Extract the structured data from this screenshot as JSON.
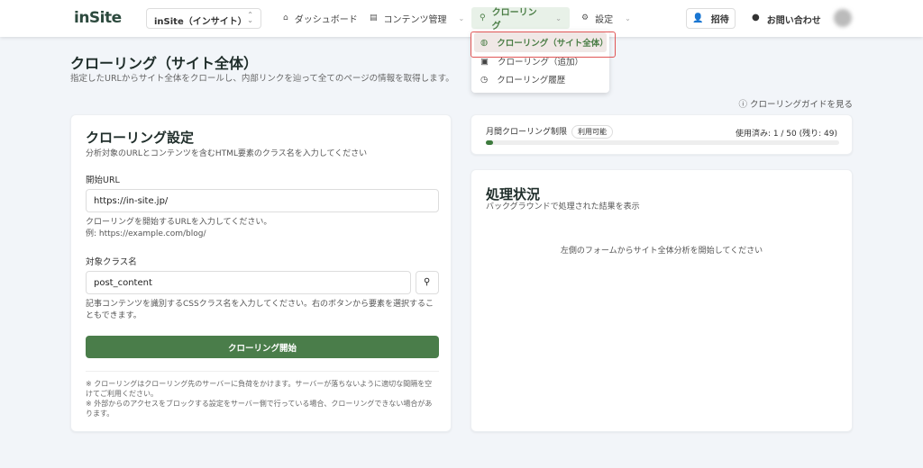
{
  "header": {
    "logo": "inSite",
    "site_selector": "inSite（インサイト）",
    "nav": [
      {
        "label": "ダッシュボード",
        "icon": "home-icon"
      },
      {
        "label": "コンテンツ管理",
        "icon": "document-icon"
      },
      {
        "label": "クローリング",
        "icon": "search-icon",
        "active": true
      },
      {
        "label": "設定",
        "icon": "gear-icon"
      }
    ],
    "invite": "招待",
    "contact": "お問い合わせ"
  },
  "dropdown": [
    {
      "label": "クローリング（サイト全体）",
      "icon": "globe-icon",
      "selected": true
    },
    {
      "label": "クローリング（追加）",
      "icon": "search-box-icon"
    },
    {
      "label": "クローリング履歴",
      "icon": "history-icon"
    }
  ],
  "page": {
    "title": "クローリング（サイト全体）",
    "subtitle": "指定したURLからサイト全体をクロールし、内部リンクを辿って全てのページの情報を取得します。",
    "guide_link": "クローリングガイドを見る"
  },
  "settings": {
    "title": "クローリング設定",
    "subtitle": "分析対象のURLとコンテンツを含むHTML要素のクラス名を入力してください",
    "start_url_label": "開始URL",
    "start_url_value": "https://in-site.jp/",
    "start_url_help1": "クローリングを開始するURLを入力してください。",
    "start_url_help2": "例: https://example.com/blog/",
    "class_label": "対象クラス名",
    "class_value": "post_content",
    "class_help": "記事コンテンツを識別するCSSクラス名を入力してください。右のボタンから要素を選択することもできます。",
    "start_button": "クローリング開始",
    "note1": "※ クローリングはクローリング先のサーバーに負荷をかけます。サーバーが落ちないように適切な間隔を空けてご利用ください。",
    "note2": "※ 外部からのアクセスをブロックする設定をサーバー側で行っている場合、クローリングできない場合があります。"
  },
  "limit": {
    "label": "月間クローリング制限",
    "badge": "利用可能",
    "usage": "使用済み: 1 / 50 (残り: 49)",
    "used_fraction": 0.02
  },
  "status": {
    "title": "処理状況",
    "subtitle": "バックグラウンドで処理された結果を表示",
    "empty": "左側のフォームからサイト全体分析を開始してください"
  }
}
